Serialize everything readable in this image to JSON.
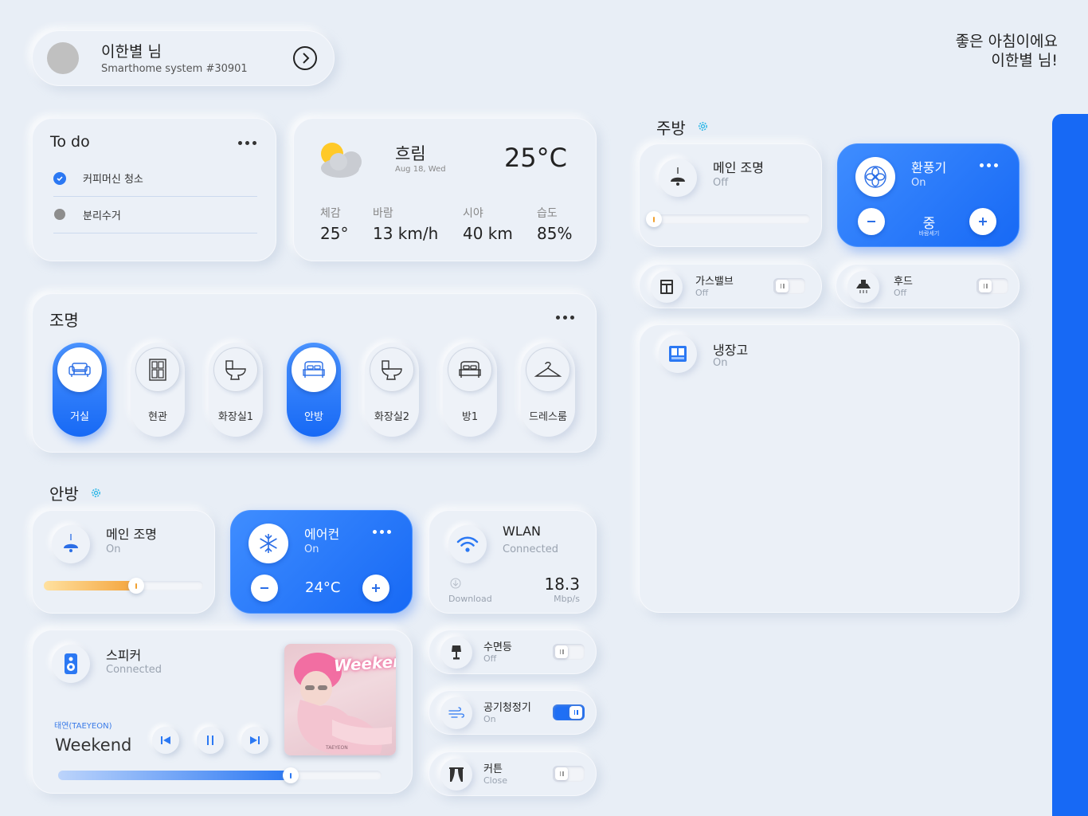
{
  "user": {
    "name": "이한별 님",
    "system": "Smarthome system #30901"
  },
  "greeting": {
    "line1": "좋은 아침이에요",
    "line2": "이한별 님!"
  },
  "todo": {
    "title": "To do",
    "items": [
      {
        "label": "커피머신 청소",
        "done": true
      },
      {
        "label": "분리수거",
        "done": false
      }
    ]
  },
  "weather": {
    "condition": "흐림",
    "date": "Aug 18, Wed",
    "temp": "25°C",
    "stats": [
      {
        "label": "체감",
        "value": "25°"
      },
      {
        "label": "바람",
        "value": "13 km/h"
      },
      {
        "label": "시야",
        "value": "40 km"
      },
      {
        "label": "습도",
        "value": "85%"
      }
    ]
  },
  "lighting": {
    "title": "조명",
    "rooms": [
      {
        "label": "거실",
        "icon": "sofa-icon",
        "active": true
      },
      {
        "label": "현관",
        "icon": "door-icon",
        "active": false
      },
      {
        "label": "화장실1",
        "icon": "toilet-icon",
        "active": false
      },
      {
        "label": "안방",
        "icon": "bed-icon",
        "active": true
      },
      {
        "label": "화장실2",
        "icon": "toilet-icon",
        "active": false
      },
      {
        "label": "방1",
        "icon": "bed-icon",
        "active": false
      },
      {
        "label": "드레스룸",
        "icon": "hanger-icon",
        "active": false
      }
    ]
  },
  "bedroom": {
    "title": "안방",
    "main_light": {
      "name": "메인 조명",
      "status": "On",
      "level": 0.58
    },
    "aircon": {
      "name": "에어컨",
      "status": "On",
      "temp": "24°C"
    },
    "wlan": {
      "name": "WLAN",
      "status": "Connected",
      "download_label": "Download",
      "speed": "18.3",
      "unit": "Mbp/s"
    },
    "speaker": {
      "name": "스피커",
      "status": "Connected",
      "artist": "태연(TAEYEON)",
      "track": "Weekend",
      "progress": 0.72,
      "album_title": "Weekend",
      "album_artist": "TAEYEON"
    },
    "sleep_light": {
      "name": "수면등",
      "status": "Off",
      "on": false
    },
    "air_purifier": {
      "name": "공기청정기",
      "status": "On",
      "on": true
    },
    "curtain": {
      "name": "커튼",
      "status": "Close",
      "on": false
    }
  },
  "kitchen": {
    "title": "주방",
    "main_light": {
      "name": "메인 조명",
      "status": "Off",
      "level": 0.02
    },
    "fan": {
      "name": "환풍기",
      "status": "On",
      "level": "중",
      "level_label": "바람세기"
    },
    "gas_valve": {
      "name": "가스밸브",
      "status": "Off",
      "on": false
    },
    "hood": {
      "name": "후드",
      "status": "Off",
      "on": false
    },
    "fridge": {
      "name": "냉장고",
      "status": "On"
    }
  },
  "colors": {
    "accent": "#1769f5",
    "background": "#e8eef6",
    "gear": "#2bb6e6"
  }
}
